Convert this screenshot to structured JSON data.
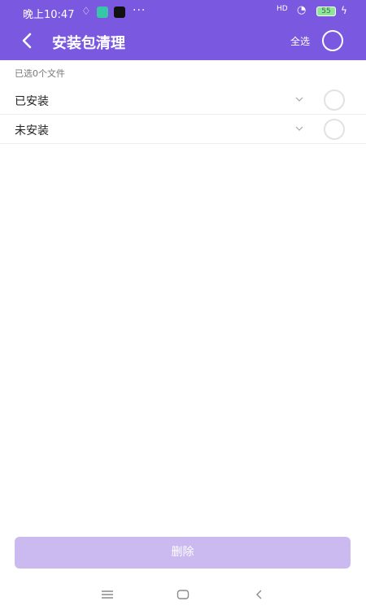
{
  "status_bar": {
    "time": "晚上10:47",
    "more": "···",
    "network": "HD",
    "battery": "55"
  },
  "toolbar": {
    "title": "安装包清理",
    "select_all": "全选"
  },
  "summary": {
    "selected_text": "已选0个文件"
  },
  "groups": [
    {
      "label": "已安装"
    },
    {
      "label": "未安装"
    }
  ],
  "actions": {
    "delete_label": "删除"
  },
  "colors": {
    "accent": "#7a58e0",
    "button_disabled": "#cbbaf0"
  },
  "icons": {
    "back": "chevron-left-icon",
    "expand": "chevron-down-icon",
    "menu": "menu-icon",
    "home": "home-icon",
    "nav_back": "back-icon"
  }
}
